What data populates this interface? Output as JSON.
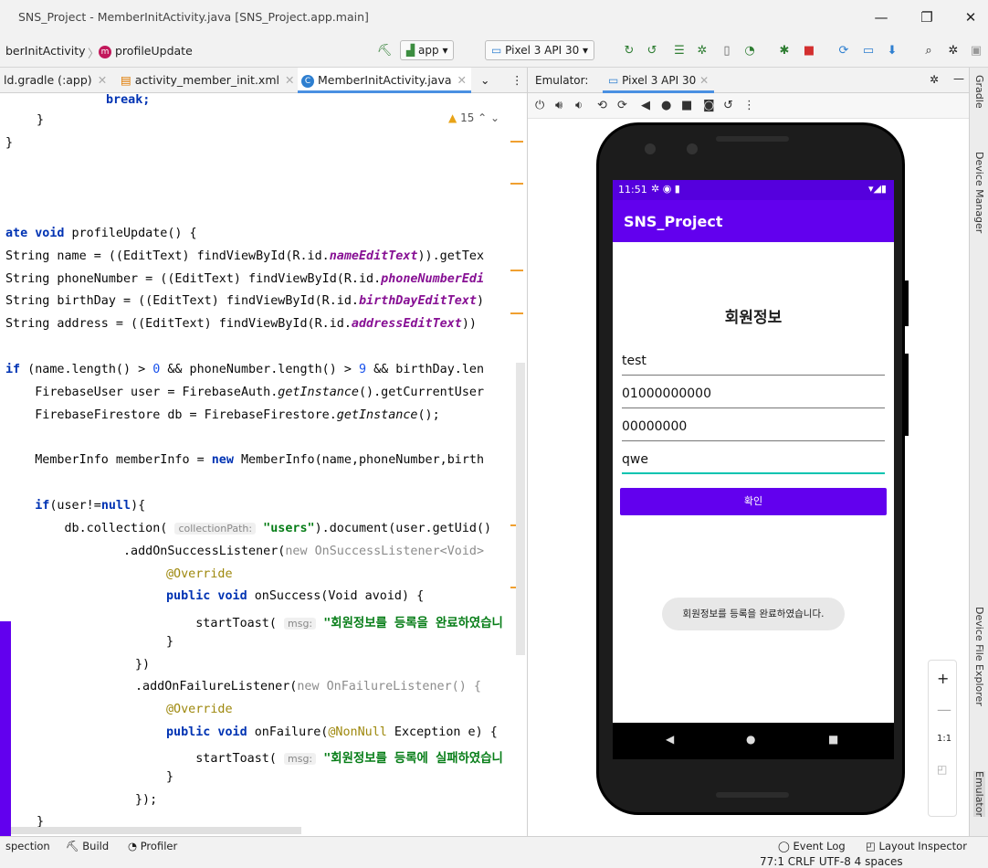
{
  "window": {
    "title": "SNS_Project - MemberInitActivity.java [SNS_Project.app.main]",
    "min": "—",
    "max": "❐",
    "close": "✕"
  },
  "navbar": {
    "crumb1": "berInitActivity",
    "crumb_sep": "〉",
    "crumb2_badge": "m",
    "crumb2": "profileUpdate",
    "app_combo": "app ▾",
    "device_combo": "Pixel 3 API 30 ▾"
  },
  "tabs": [
    {
      "label": "ld.gradle (:app)"
    },
    {
      "label": "activity_member_init.xml"
    },
    {
      "label": "MemberInitActivity.java"
    }
  ],
  "warnings": {
    "count": "15",
    "arrows": "⌃ ⌄"
  },
  "code_lines": {
    "l1": "break;",
    "l2": "}",
    "l3": "}",
    "l4_kw": "ate void",
    "l4": " profileUpdate() {",
    "l5a": "String name = ((EditText) findViewById(R.id.",
    "l5b": "nameEditText",
    "l5c": ")).getTex",
    "l6a": "String phoneNumber = ((EditText) findViewById(R.id.",
    "l6b": "phoneNumberEdi",
    "l7a": "String birthDay = ((EditText) findViewById(R.id.",
    "l7b": "birthDayEditText",
    "l7c": ")",
    "l8a": "String address = ((EditText) findViewById(R.id.",
    "l8b": "addressEditText",
    "l8c": "))",
    "l9a": "if",
    "l9b": " (name.length() > ",
    "l9c": "0",
    "l9d": " && phoneNumber.length() > ",
    "l9e": "9",
    "l9f": " && birthDay.len",
    "l10a": "    FirebaseUser user = FirebaseAuth.",
    "l10b": "getInstance",
    "l10c": "().getCurrentUser",
    "l11a": "    FirebaseFirestore db = FirebaseFirestore.",
    "l11b": "getInstance",
    "l11c": "();",
    "l12a": "    MemberInfo memberInfo = ",
    "l12b": "new",
    "l12c": " MemberInfo(name,phoneNumber,birth",
    "l13a": "    if",
    "l13b": "(user!=",
    "l13c": "null",
    "l13d": "){",
    "l14a": "        db.collection( ",
    "l14hint": "collectionPath:",
    "l14b": " \"users\"",
    "l14c": ").document(user.getUid()",
    "l15a": "                .addOnSuccessListener(",
    "l15b": "new",
    "l15c": " OnSuccessListener<Void>",
    "l16": "@Override",
    "l17a": "public void",
    "l17b": " onSuccess(Void avoid) {",
    "l18a": "    startToast( ",
    "l18hint": "msg:",
    "l18b": " \"회원정보를 등록을 완료하였습니",
    "l19": "}",
    "l20": "})",
    "l21a": ".addOnFailureListener(",
    "l21b": "new",
    "l21c": " OnFailureListener() {",
    "l22": "@Override",
    "l23a": "public void",
    "l23b": " onFailure(",
    "l23c": "@NonNull",
    "l23d": " Exception e) {",
    "l24a": "    startToast( ",
    "l24hint": "msg:",
    "l24b": " \"회원정보를 등록에 실패하였습니",
    "l25": "}",
    "l26": "});",
    "l27": "}"
  },
  "emulator": {
    "label": "Emulator:",
    "device_tab": "Pixel 3 API 30",
    "status_time": "11:51",
    "app_title": "SNS_Project",
    "heading": "회원정보",
    "fields": [
      "test",
      "01000000000",
      "00000000",
      "qwe"
    ],
    "confirm": "확인",
    "toast": "회원정보를 등록을 완료하였습니다.",
    "zoom_label": "1:1"
  },
  "right_strip": [
    "Gradle",
    "Device Manager",
    "Device File Explorer",
    "Emulator"
  ],
  "bottom": {
    "inspection": "spection",
    "build": "Build",
    "profiler": "Profiler",
    "event_log": "Event Log",
    "layout_inspector": "Layout Inspector",
    "status": "77:1  CRLF  UTF-8  4 spaces"
  }
}
